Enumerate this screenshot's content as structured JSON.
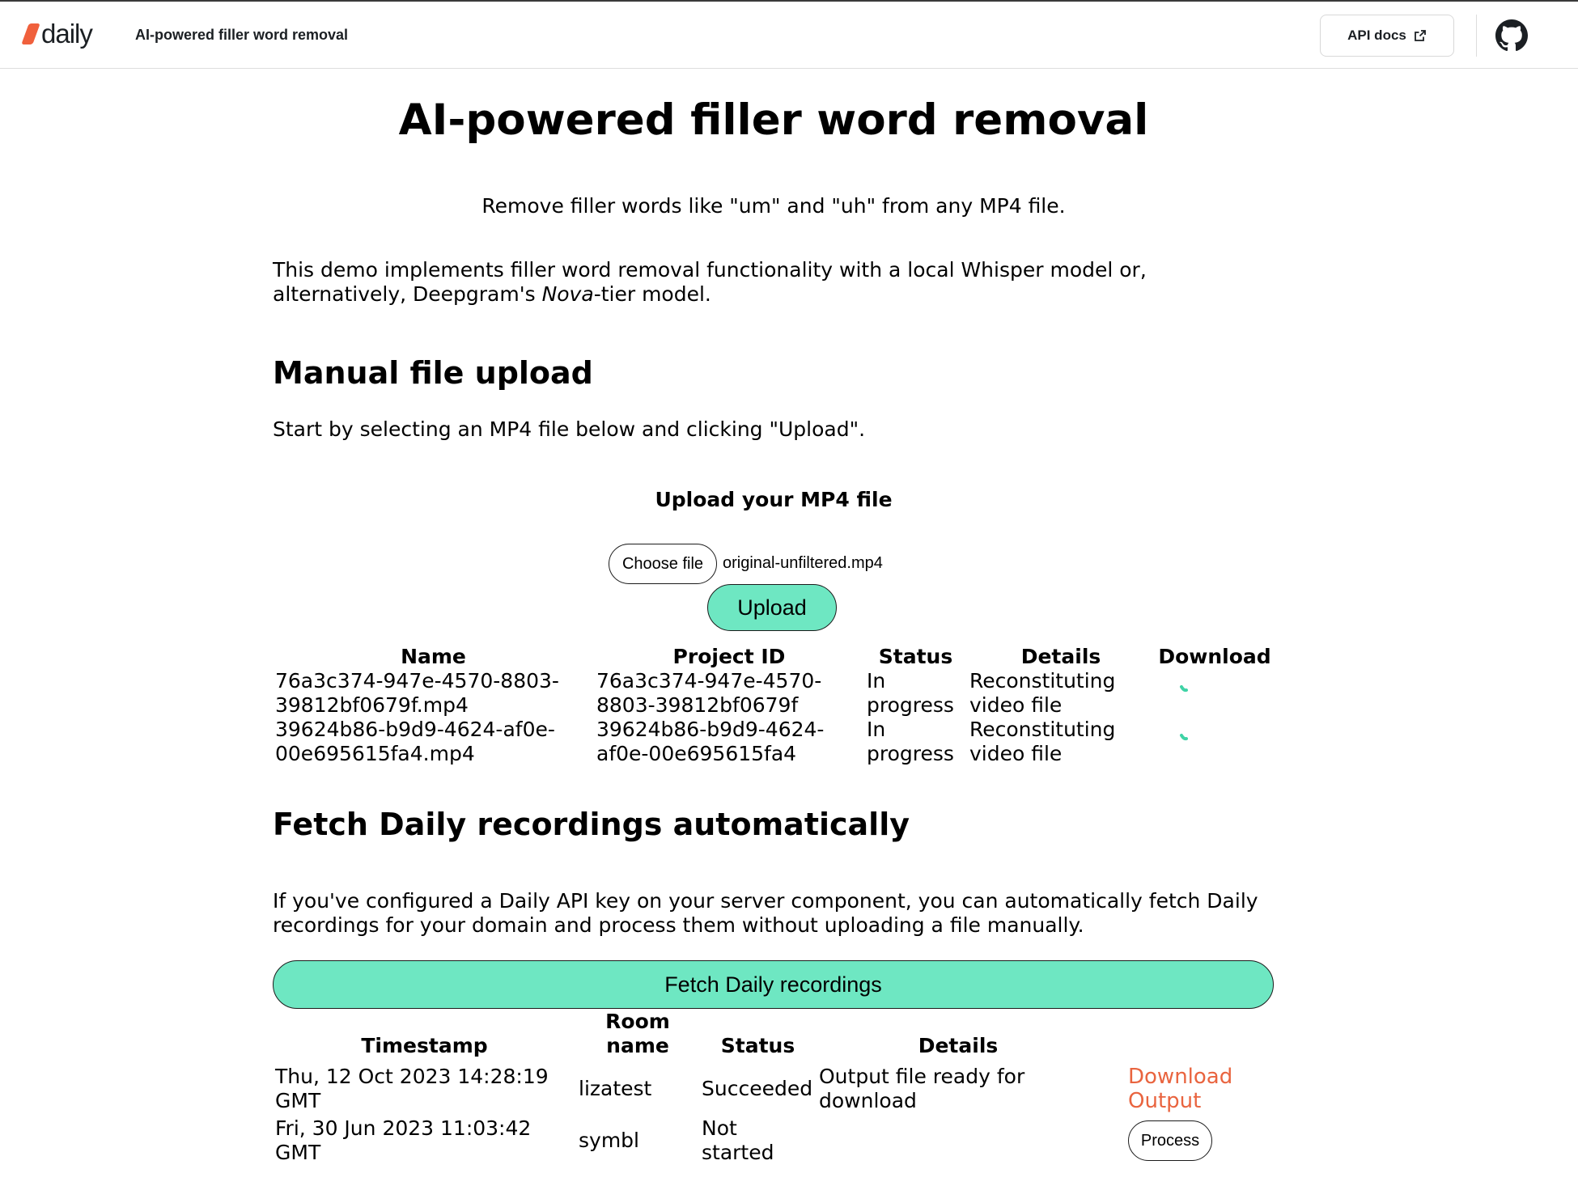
{
  "header": {
    "logo_text": "daily",
    "title": "AI-powered filler word removal",
    "api_docs_label": "API docs"
  },
  "main": {
    "title": "AI-powered filler word removal",
    "subtitle": "Remove filler words like \"um\" and \"uh\" from any MP4 file.",
    "intro_before": "This demo implements filler word removal functionality with a local Whisper model or, alternatively, Deepgram's ",
    "intro_em": "Nova",
    "intro_after": "-tier model."
  },
  "manual_upload": {
    "heading": "Manual file upload",
    "description": "Start by selecting an MP4 file below and clicking \"Upload\".",
    "upload_title": "Upload your MP4 file",
    "choose_file_label": "Choose file",
    "selected_file": "original-unfiltered.mp4",
    "upload_label": "Upload",
    "columns": [
      "Name",
      "Project ID",
      "Status",
      "Details",
      "Download"
    ],
    "rows": [
      {
        "name": "76a3c374-947e-4570-8803-39812bf0679f.mp4",
        "project_id": "76a3c374-947e-4570-8803-39812bf0679f",
        "status": "In progress",
        "details": "Reconstituting video file"
      },
      {
        "name": "39624b86-b9d9-4624-af0e-00e695615fa4.mp4",
        "project_id": "39624b86-b9d9-4624-af0e-00e695615fa4",
        "status": "In progress",
        "details": "Reconstituting video file"
      }
    ]
  },
  "fetch_recordings": {
    "heading": "Fetch Daily recordings automatically",
    "description": "If you've configured a Daily API key on your server component, you can automatically fetch Daily recordings for your domain and process them without uploading a file manually.",
    "fetch_label": "Fetch Daily recordings",
    "columns": [
      "Timestamp",
      "Room name",
      "Status",
      "Details"
    ],
    "rows": [
      {
        "timestamp": "Thu, 12 Oct 2023 14:28:19 GMT",
        "room": "lizatest",
        "status": "Succeeded",
        "details": "Output file ready for download",
        "action_label": "Download Output"
      },
      {
        "timestamp": "Fri, 30 Jun 2023 11:03:42 GMT",
        "room": "symbl",
        "status": "Not started",
        "details": "",
        "action_label": "Process"
      }
    ]
  },
  "colors": {
    "accent_button": "#6ee7c2",
    "link": "#e9643f",
    "logo": "#f0603c",
    "spinner": "#3fd3a6"
  }
}
